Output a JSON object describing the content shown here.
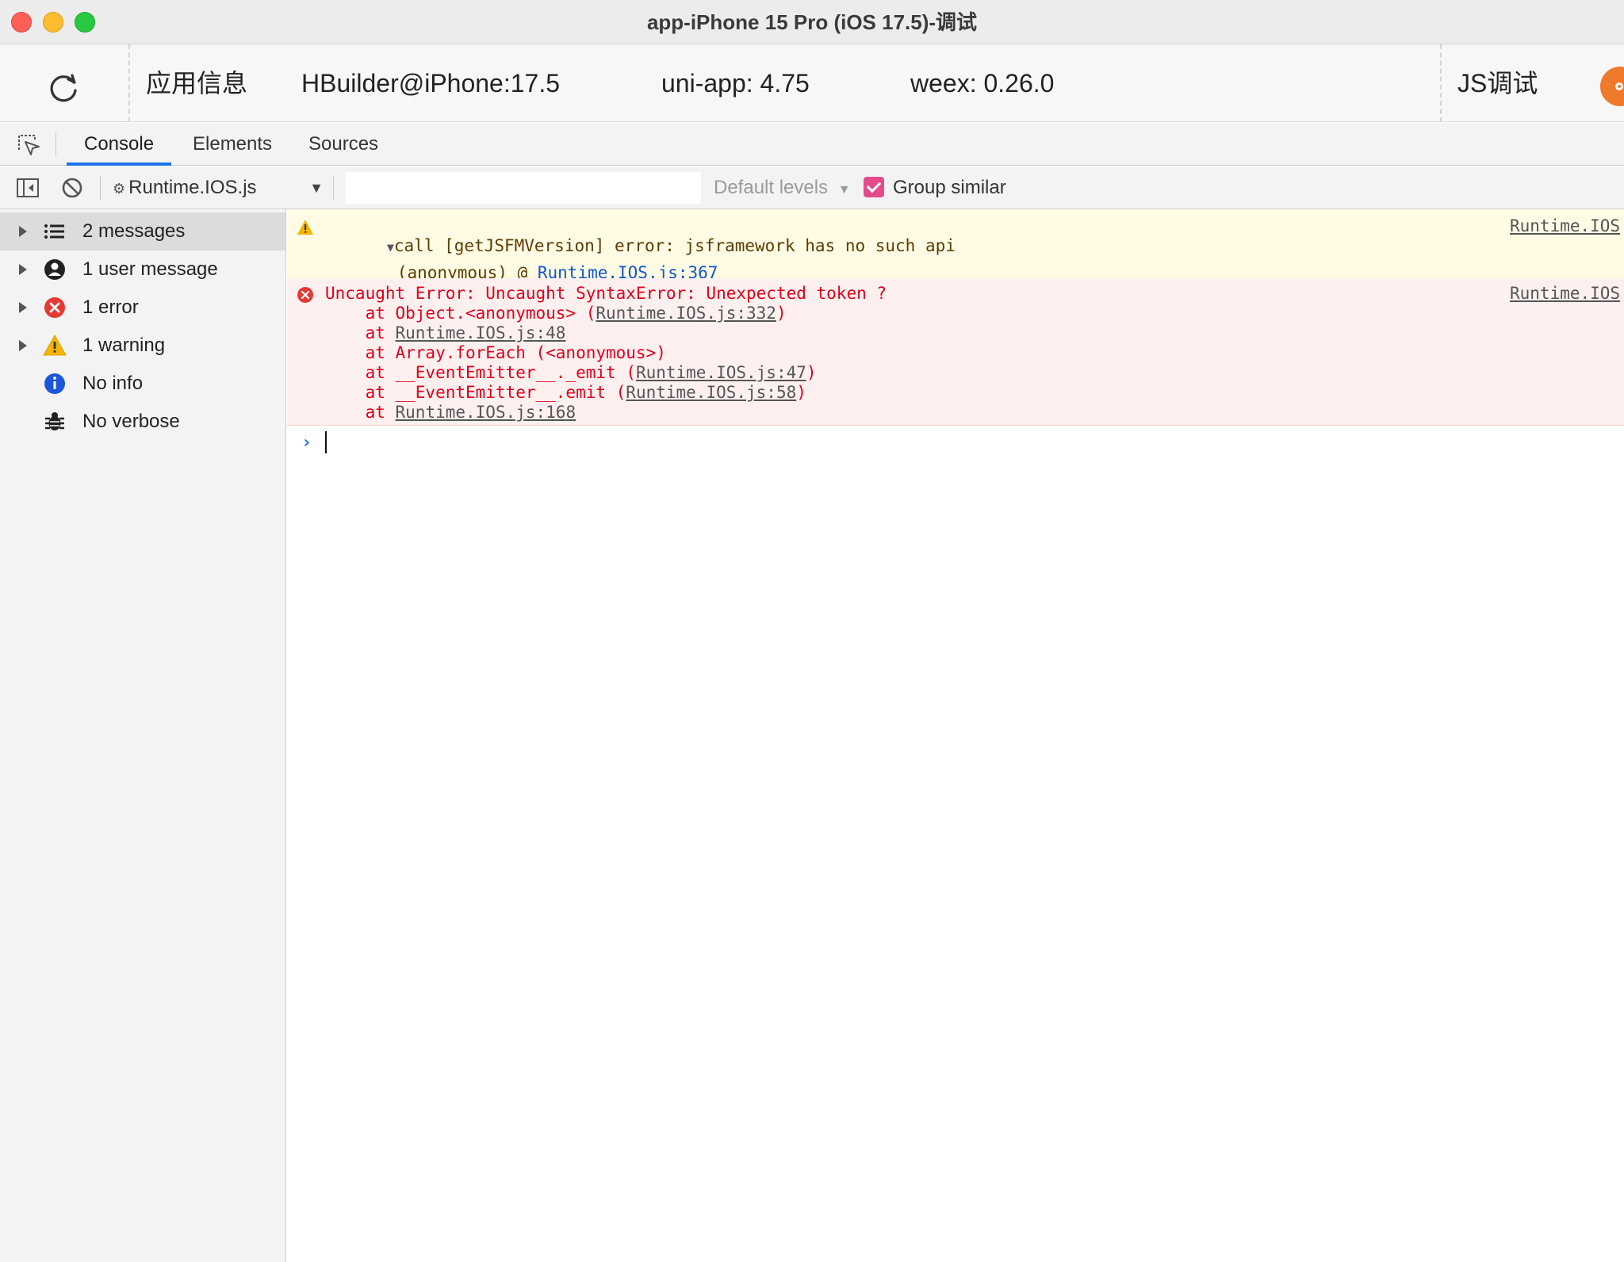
{
  "window": {
    "title": "app-iPhone 15 Pro (iOS 17.5)-调试"
  },
  "infobar": {
    "app_info_label": "应用信息",
    "device": "HBuilder@iPhone:17.5",
    "uniapp_version": "uni-app: 4.75",
    "weex_version": "weex: 0.26.0",
    "js_debug_label": "JS调试"
  },
  "tabs": [
    {
      "label": "Console",
      "active": true
    },
    {
      "label": "Elements",
      "active": false
    },
    {
      "label": "Sources",
      "active": false
    }
  ],
  "toolbar": {
    "context": "Runtime.IOS.js",
    "filter_value": "",
    "levels": "Default levels",
    "group_similar_label": "Group similar",
    "group_similar_checked": true,
    "check_color": "#e34b8d"
  },
  "sidebar": {
    "items": [
      {
        "label": "2 messages",
        "icon": "list-icon",
        "expandable": true,
        "selected": true
      },
      {
        "label": "1 user message",
        "icon": "user-icon",
        "expandable": true,
        "selected": false
      },
      {
        "label": "1 error",
        "icon": "error-icon",
        "expandable": true,
        "selected": false
      },
      {
        "label": "1 warning",
        "icon": "warning-icon",
        "expandable": true,
        "selected": false
      },
      {
        "label": "No info",
        "icon": "info-icon",
        "expandable": false,
        "selected": false
      },
      {
        "label": "No verbose",
        "icon": "bug-icon",
        "expandable": false,
        "selected": false
      }
    ]
  },
  "console": {
    "warning": {
      "expander": "▼",
      "text": "call [getJSFMVersion] error: jsframework has no such api",
      "stack_prefix": "(anonymous) @ ",
      "stack_link": "Runtime.IOS.js:367",
      "source": "Runtime.IOS"
    },
    "error": {
      "text": "Uncaught Error: Uncaught SyntaxError: Unexpected token ?",
      "source": "Runtime.IOS",
      "stack": [
        {
          "prefix": "    at Object.<anonymous> (",
          "link": "Runtime.IOS.js:332",
          "suffix": ")"
        },
        {
          "prefix": "    at ",
          "link": "Runtime.IOS.js:48",
          "suffix": ""
        },
        {
          "prefix": "    at Array.forEach (<anonymous>)",
          "link": "",
          "suffix": ""
        },
        {
          "prefix": "    at __EventEmitter__._emit (",
          "link": "Runtime.IOS.js:47",
          "suffix": ")"
        },
        {
          "prefix": "    at __EventEmitter__.emit (",
          "link": "Runtime.IOS.js:58",
          "suffix": ")"
        },
        {
          "prefix": "    at ",
          "link": "Runtime.IOS.js:168",
          "suffix": ""
        }
      ]
    },
    "prompt_symbol": "›"
  },
  "colors": {
    "accent": "#1a73e8",
    "warning_bg": "#fffbe5",
    "error_bg": "#fff0f0",
    "error_text": "#e0001a"
  }
}
